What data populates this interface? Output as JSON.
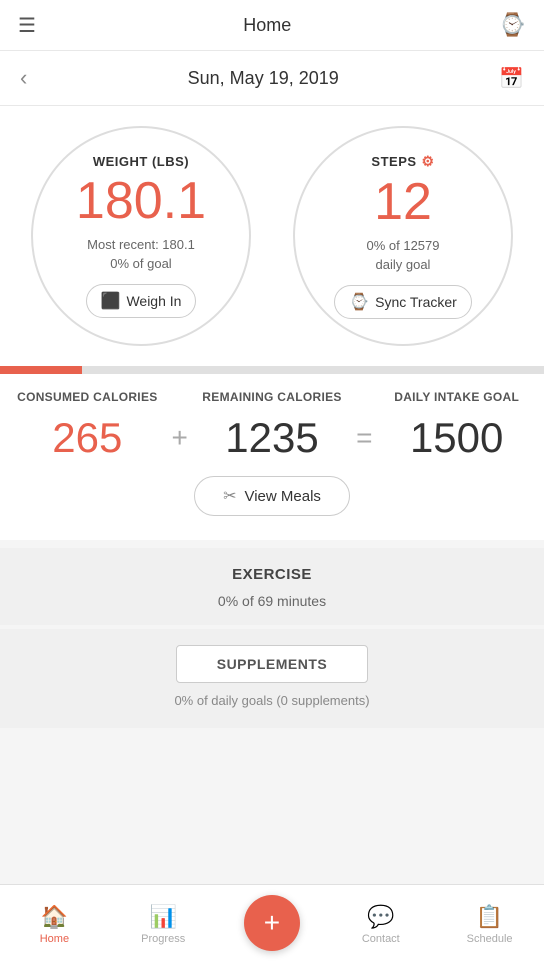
{
  "topNav": {
    "title": "Home",
    "hamburgerLabel": "☰",
    "watchIcon": "⌚"
  },
  "dateHeader": {
    "backIcon": "‹",
    "dateText": "Sun, May 19, 2019",
    "calendarIcon": "📅"
  },
  "weightCard": {
    "label": "WEIGHT (LBS)",
    "value": "180.1",
    "subLine1": "Most recent: 180.1",
    "subLine2": "0% of goal",
    "btnLabel": "Weigh In",
    "btnIcon": "⬛"
  },
  "stepsCard": {
    "label": "STEPS",
    "gearIcon": "⚙",
    "value": "12",
    "subLine1": "0% of 12579",
    "subLine2": "daily goal",
    "btnLabel": "Sync Tracker",
    "btnIcon": "⌚"
  },
  "progressBar": {
    "fillPercent": 15
  },
  "calories": {
    "consumedLabel": "CONSUMED CALORIES",
    "remainingLabel": "REMAINING CALORIES",
    "dailyLabel": "DAILY INTAKE GOAL",
    "consumedValue": "265",
    "plusOperator": "+",
    "remainingValue": "1235",
    "equalsOperator": "=",
    "dailyValue": "1500",
    "viewMealsLabel": "View Meals"
  },
  "exercise": {
    "title": "EXERCISE",
    "subText": "0% of 69 minutes"
  },
  "supplements": {
    "btnLabel": "SUPPLEMENTS",
    "subText": "0% of daily goals (0 supplements)"
  },
  "bottomNav": {
    "items": [
      {
        "label": "Home",
        "icon": "🏠",
        "active": true
      },
      {
        "label": "Progress",
        "icon": "📊",
        "active": false
      },
      {
        "label": "+",
        "icon": "+",
        "active": false,
        "fab": true
      },
      {
        "label": "Contact",
        "icon": "💬",
        "active": false
      },
      {
        "label": "Schedule",
        "icon": "📋",
        "active": false
      }
    ]
  }
}
